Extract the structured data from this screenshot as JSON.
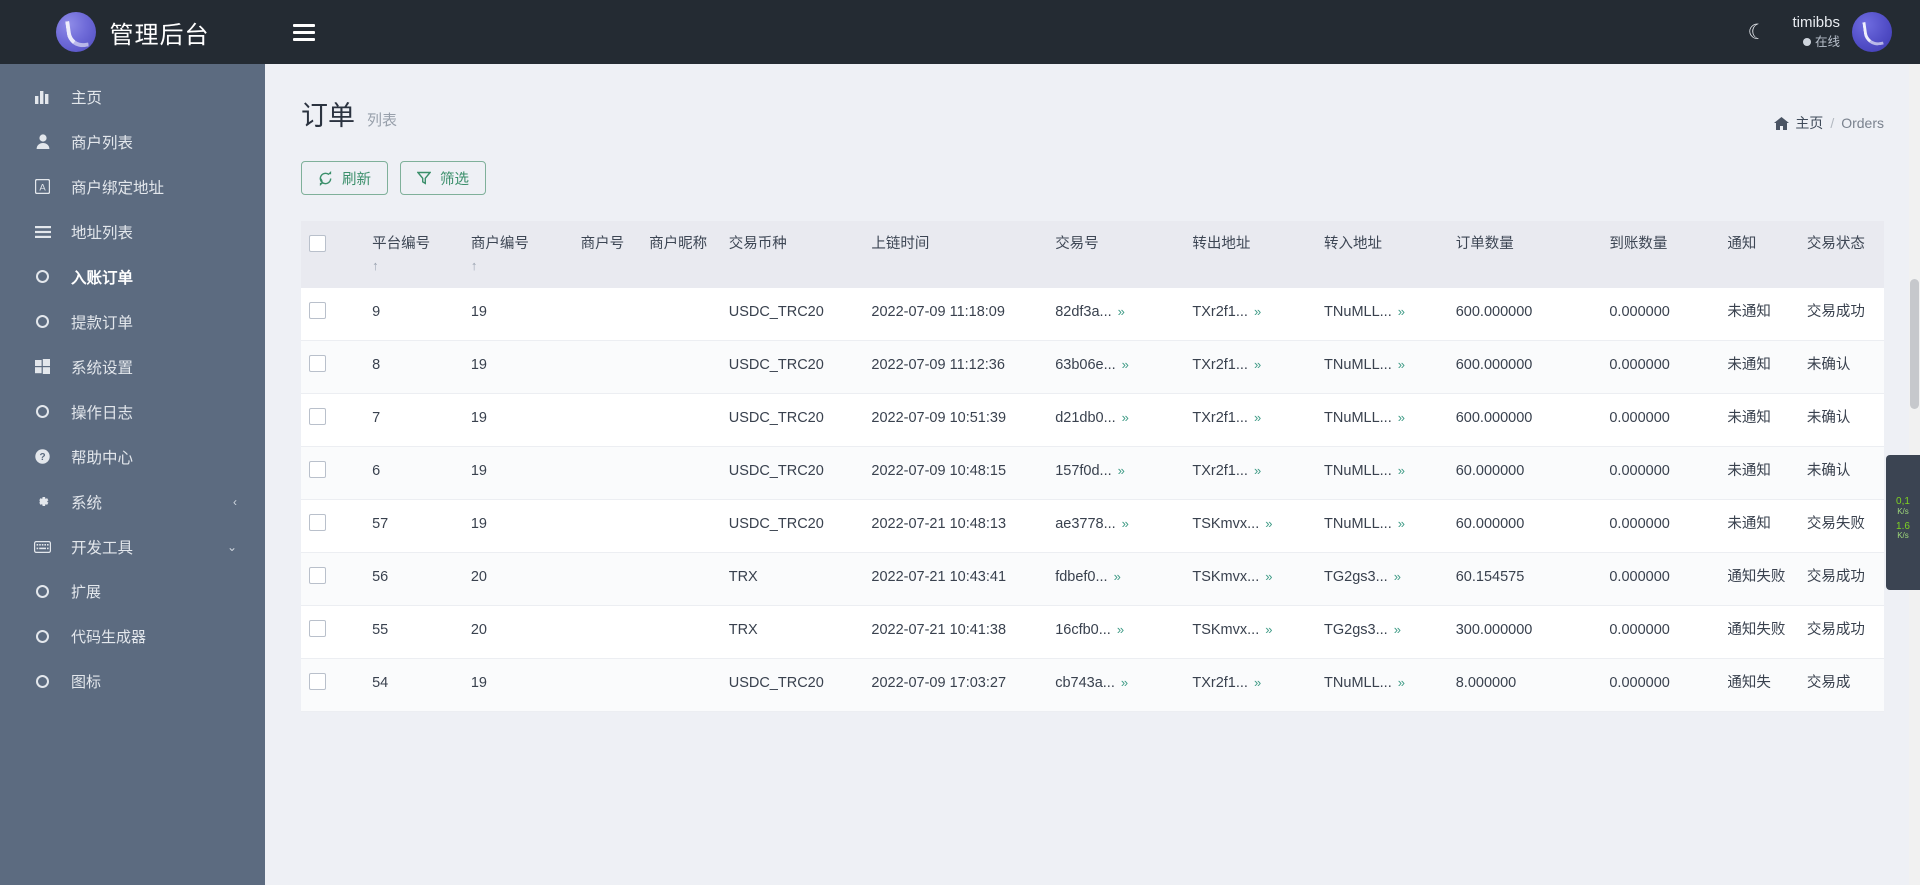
{
  "brand": {
    "title": "管理后台",
    "logo_icon": "app-logo-icon"
  },
  "topbar": {
    "menu_icon": "hamburger-menu-icon",
    "theme_icon": "moon-icon",
    "user_name": "timibbs",
    "user_status": "在线",
    "avatar_icon": "user-avatar-icon"
  },
  "sidebar": {
    "items": [
      {
        "label": "主页",
        "icon": "chart-bar-icon",
        "active": false
      },
      {
        "label": "商户列表",
        "icon": "user-icon",
        "active": false
      },
      {
        "label": "商户绑定地址",
        "icon": "letter-a-icon",
        "active": false
      },
      {
        "label": "地址列表",
        "icon": "list-icon",
        "active": false
      },
      {
        "label": "入账订单",
        "icon": "circle-icon",
        "active": true
      },
      {
        "label": "提款订单",
        "icon": "circle-icon",
        "active": false
      },
      {
        "label": "系统设置",
        "icon": "windows-icon",
        "active": false
      },
      {
        "label": "操作日志",
        "icon": "circle-icon",
        "active": false
      },
      {
        "label": "帮助中心",
        "icon": "question-circle-icon",
        "active": false
      },
      {
        "label": "系统",
        "icon": "gear-icon",
        "active": false,
        "caret": "‹"
      },
      {
        "label": "开发工具",
        "icon": "keyboard-icon",
        "active": false,
        "caret": "⌄"
      }
    ],
    "sub_items": [
      {
        "label": "扩展",
        "icon": "circle-icon"
      },
      {
        "label": "代码生成器",
        "icon": "circle-icon"
      },
      {
        "label": "图标",
        "icon": "circle-icon"
      }
    ]
  },
  "page": {
    "title": "订单",
    "subtitle": "列表",
    "breadcrumb_home": "主页",
    "breadcrumb_sep": "/",
    "breadcrumb_current": "Orders",
    "breadcrumb_icon": "home-icon"
  },
  "toolbar": {
    "refresh_label": "刷新",
    "refresh_icon": "refresh-icon",
    "filter_label": "筛选",
    "filter_icon": "funnel-icon",
    "accent_color": "#3b8f6b"
  },
  "table": {
    "select_all_icon": "checkbox-icon",
    "sort_icon": "sort-asc-icon",
    "expand_icon": "double-chevron-down-icon",
    "columns": [
      {
        "label": "平台编号",
        "sort": "↑"
      },
      {
        "label": "商户编号",
        "sort": "↑"
      },
      {
        "label": "商户号",
        "sort": ""
      },
      {
        "label": "商户昵称",
        "sort": ""
      },
      {
        "label": "交易币种",
        "sort": ""
      },
      {
        "label": "上链时间",
        "sort": ""
      },
      {
        "label": "交易号",
        "sort": ""
      },
      {
        "label": "转出地址",
        "sort": ""
      },
      {
        "label": "转入地址",
        "sort": ""
      },
      {
        "label": "订单数量",
        "sort": ""
      },
      {
        "label": "到账数量",
        "sort": ""
      },
      {
        "label": "通知",
        "sort": ""
      },
      {
        "label": "交易状态",
        "sort": ""
      }
    ],
    "rows": [
      {
        "platform_id": "9",
        "merchant_id": "19",
        "merchant_no": "",
        "merchant_nick": "",
        "currency": "USDC_TRC20",
        "time": "2022-07-09 11:18:09",
        "tx": "82df3a...",
        "from": "TXr2f1...",
        "to": "TNuMLL...",
        "amount": "600.000000",
        "received": "0.000000",
        "notify": "未通知",
        "status": "交易成功"
      },
      {
        "platform_id": "8",
        "merchant_id": "19",
        "merchant_no": "",
        "merchant_nick": "",
        "currency": "USDC_TRC20",
        "time": "2022-07-09 11:12:36",
        "tx": "63b06e...",
        "from": "TXr2f1...",
        "to": "TNuMLL...",
        "amount": "600.000000",
        "received": "0.000000",
        "notify": "未通知",
        "status": "未确认"
      },
      {
        "platform_id": "7",
        "merchant_id": "19",
        "merchant_no": "",
        "merchant_nick": "",
        "currency": "USDC_TRC20",
        "time": "2022-07-09 10:51:39",
        "tx": "d21db0...",
        "from": "TXr2f1...",
        "to": "TNuMLL...",
        "amount": "600.000000",
        "received": "0.000000",
        "notify": "未通知",
        "status": "未确认"
      },
      {
        "platform_id": "6",
        "merchant_id": "19",
        "merchant_no": "",
        "merchant_nick": "",
        "currency": "USDC_TRC20",
        "time": "2022-07-09 10:48:15",
        "tx": "157f0d...",
        "from": "TXr2f1...",
        "to": "TNuMLL...",
        "amount": "60.000000",
        "received": "0.000000",
        "notify": "未通知",
        "status": "未确认"
      },
      {
        "platform_id": "57",
        "merchant_id": "19",
        "merchant_no": "",
        "merchant_nick": "",
        "currency": "USDC_TRC20",
        "time": "2022-07-21 10:48:13",
        "tx": "ae3778...",
        "from": "TSKmvx...",
        "to": "TNuMLL...",
        "amount": "60.000000",
        "received": "0.000000",
        "notify": "未通知",
        "status": "交易失败"
      },
      {
        "platform_id": "56",
        "merchant_id": "20",
        "merchant_no": "",
        "merchant_nick": "",
        "currency": "TRX",
        "time": "2022-07-21 10:43:41",
        "tx": "fdbef0...",
        "from": "TSKmvx...",
        "to": "TG2gs3...",
        "amount": "60.154575",
        "received": "0.000000",
        "notify": "通知失败",
        "status": "交易成功"
      },
      {
        "platform_id": "55",
        "merchant_id": "20",
        "merchant_no": "",
        "merchant_nick": "",
        "currency": "TRX",
        "time": "2022-07-21 10:41:38",
        "tx": "16cfb0...",
        "from": "TSKmvx...",
        "to": "TG2gs3...",
        "amount": "300.000000",
        "received": "0.000000",
        "notify": "通知失败",
        "status": "交易成功"
      },
      {
        "platform_id": "54",
        "merchant_id": "19",
        "merchant_no": "",
        "merchant_nick": "",
        "currency": "USDC_TRC20",
        "time": "2022-07-09 17:03:27",
        "tx": "cb743a...",
        "from": "TXr2f1...",
        "to": "TNuMLL...",
        "amount": "8.000000",
        "received": "0.000000",
        "notify": "通知失",
        "status": "交易成"
      }
    ]
  },
  "net_widget": {
    "up_value": "0,1",
    "up_unit": "K/s",
    "down_value": "1.6",
    "down_unit": "K/s",
    "dot_color": "#7ed321"
  }
}
